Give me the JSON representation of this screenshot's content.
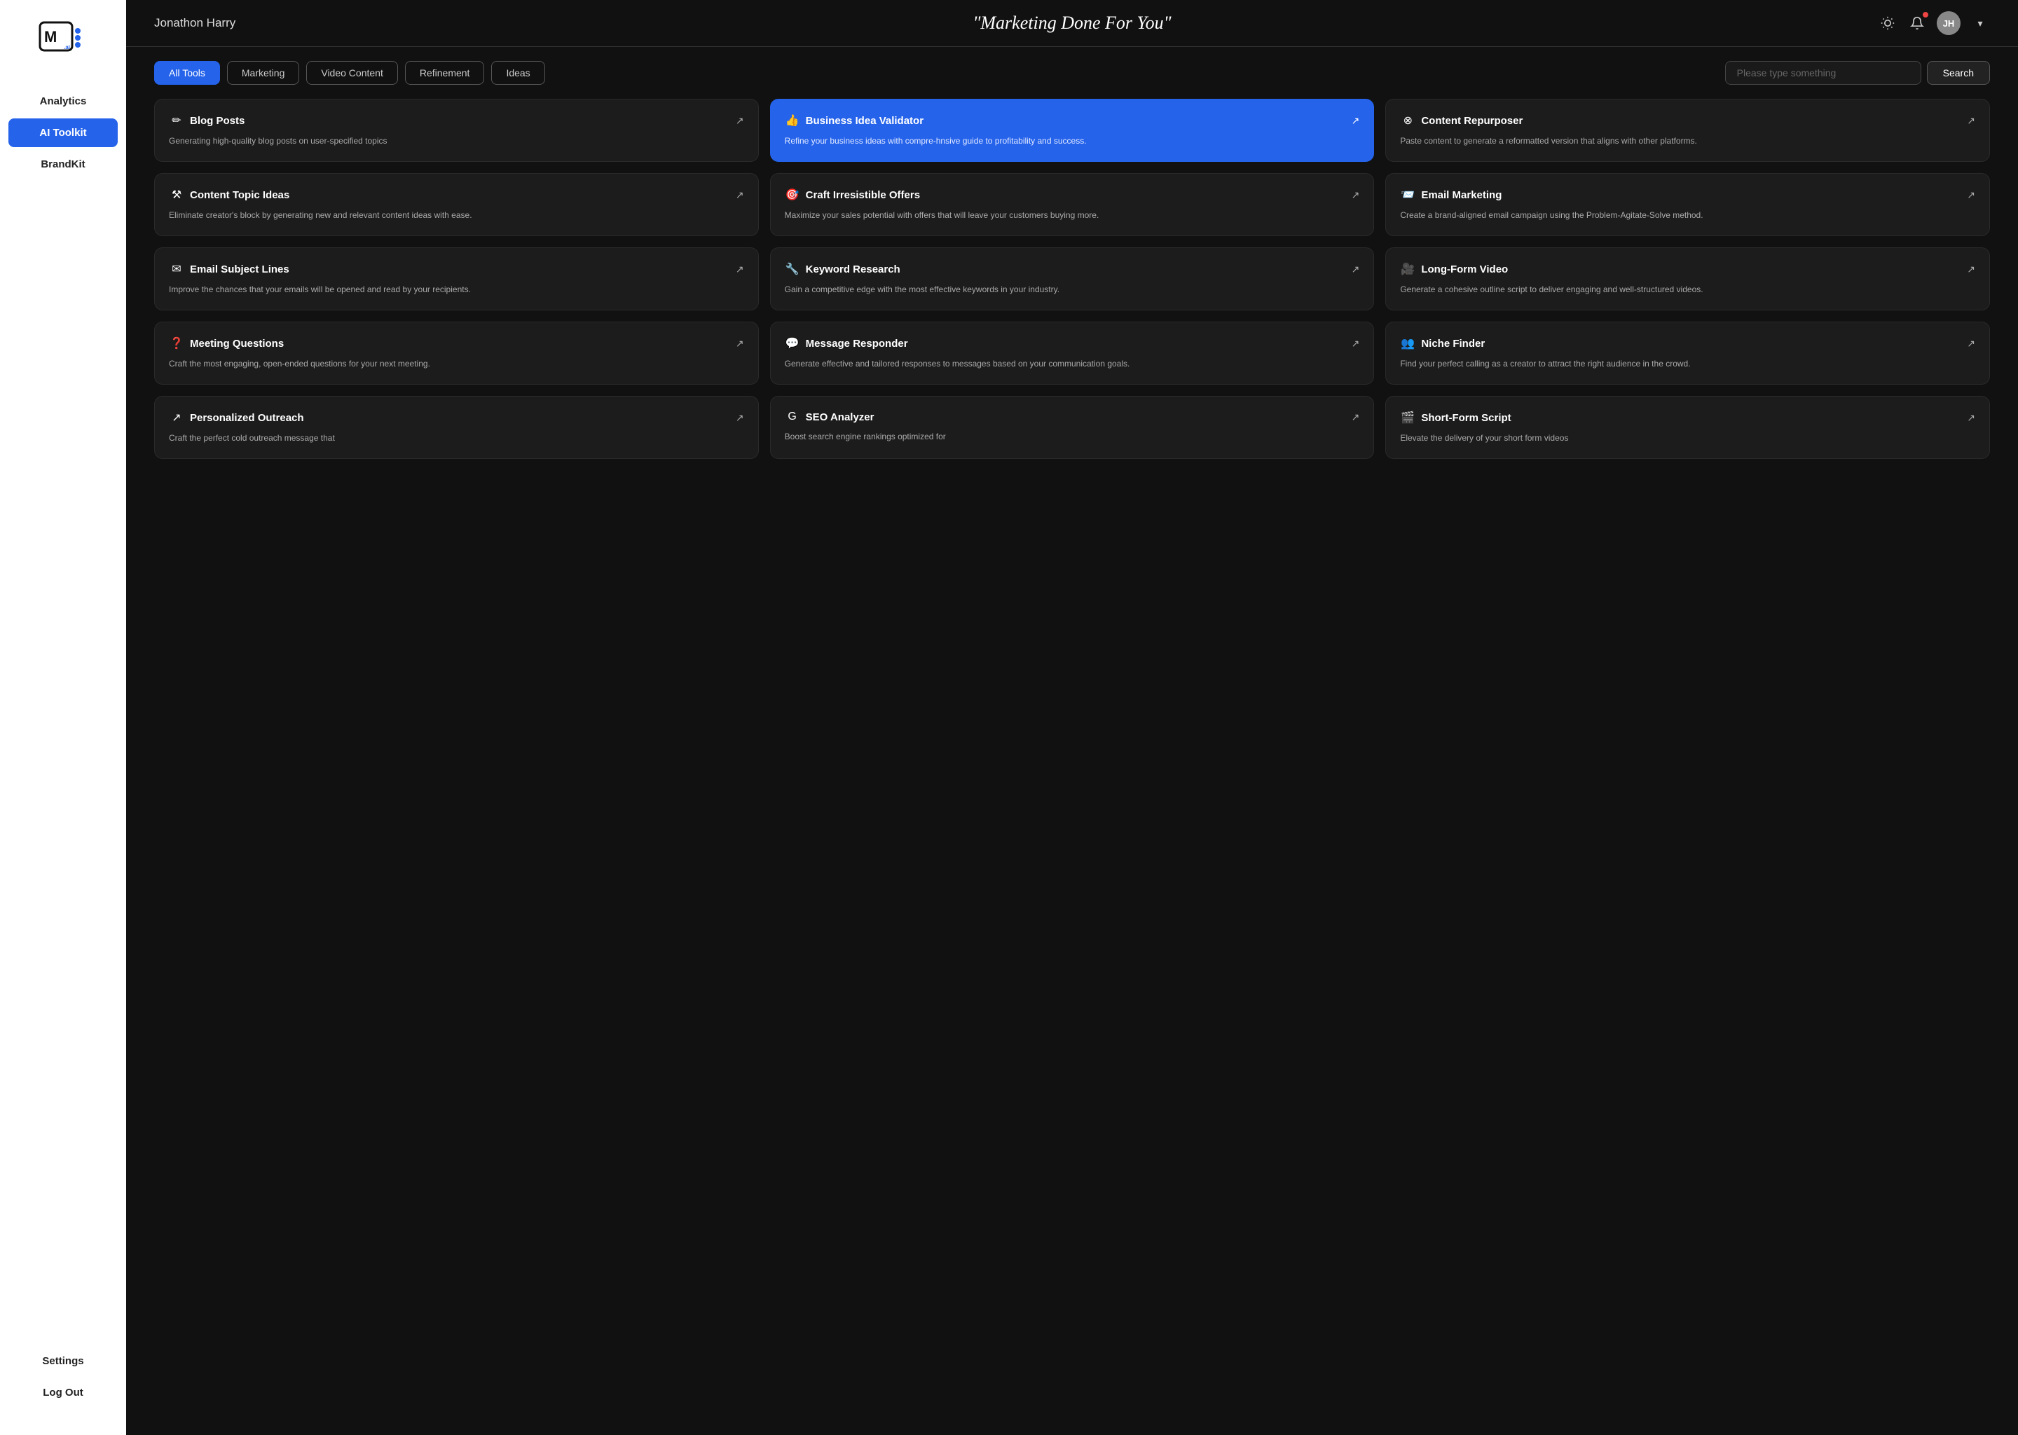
{
  "sidebar": {
    "logo_text": "M",
    "nav_items": [
      {
        "id": "analytics",
        "label": "Analytics",
        "active": false
      },
      {
        "id": "ai-toolkit",
        "label": "AI Toolkit",
        "active": true
      },
      {
        "id": "brandkit",
        "label": "BrandKit",
        "active": false
      }
    ],
    "bottom_items": [
      {
        "id": "settings",
        "label": "Settings"
      },
      {
        "id": "logout",
        "label": "Log Out"
      }
    ]
  },
  "header": {
    "user_name": "Jonathon Harry",
    "tagline": "\"Marketing Done For You\"",
    "chevron_label": "▾"
  },
  "toolbar": {
    "filters": [
      {
        "id": "all-tools",
        "label": "All Tools",
        "active": true
      },
      {
        "id": "marketing",
        "label": "Marketing",
        "active": false
      },
      {
        "id": "video-content",
        "label": "Video Content",
        "active": false
      },
      {
        "id": "refinement",
        "label": "Refinement",
        "active": false
      },
      {
        "id": "ideas",
        "label": "Ideas",
        "active": false
      }
    ],
    "search_placeholder": "Please type something",
    "search_button_label": "Search"
  },
  "tools": [
    {
      "id": "blog-posts",
      "icon": "✏️",
      "title": "Blog Posts",
      "description": "Generating high-quality blog posts on user-specified topics",
      "highlighted": false
    },
    {
      "id": "business-idea-validator",
      "icon": "👍",
      "title": "Business Idea Validator",
      "description": "Refine your business ideas with compre-hnsive guide to profitability and success.",
      "highlighted": true
    },
    {
      "id": "content-repurposer",
      "icon": "⊗",
      "title": "Content Repurposer",
      "description": "Paste content to generate a reformatted version that aligns with other platforms.",
      "highlighted": false
    },
    {
      "id": "content-topic-ideas",
      "icon": "⚒️",
      "title": "Content Topic Ideas",
      "description": "Eliminate creator's block by generating new and relevant content ideas with ease.",
      "highlighted": false
    },
    {
      "id": "craft-irresistible-offers",
      "icon": "🎯",
      "title": "Craft Irresistible Offers",
      "description": "Maximize your sales potential with offers that will leave your customers buying more.",
      "highlighted": false
    },
    {
      "id": "email-marketing",
      "icon": "📨",
      "title": "Email Marketing",
      "description": "Create a brand-aligned email campaign using the Problem-Agitate-Solve method.",
      "highlighted": false
    },
    {
      "id": "email-subject-lines",
      "icon": "✉️",
      "title": "Email Subject Lines",
      "description": "Improve the chances that your emails will be opened and read by your recipients.",
      "highlighted": false
    },
    {
      "id": "keyword-research",
      "icon": "🔧",
      "title": "Keyword Research",
      "description": "Gain a competitive edge with the most effective keywords in your industry.",
      "highlighted": false
    },
    {
      "id": "long-form-video",
      "icon": "🎥",
      "title": "Long-Form Video",
      "description": "Generate a cohesive outline script to deliver engaging and well-structured videos.",
      "highlighted": false
    },
    {
      "id": "meeting-questions",
      "icon": "❓",
      "title": "Meeting Questions",
      "description": "Craft the most engaging, open-ended questions for your next meeting.",
      "highlighted": false
    },
    {
      "id": "message-responder",
      "icon": "💬",
      "title": "Message Responder",
      "description": "Generate effective and tailored responses to messages based on your communication goals.",
      "highlighted": false
    },
    {
      "id": "niche-finder",
      "icon": "👥",
      "title": "Niche Finder",
      "description": "Find your perfect calling as a creator to attract the right audience in the crowd.",
      "highlighted": false
    },
    {
      "id": "personalized-outreach",
      "icon": "📤",
      "title": "Personalized Outreach",
      "description": "Craft the perfect cold outreach message that",
      "highlighted": false
    },
    {
      "id": "seo-analyzer",
      "icon": "G",
      "title": "SEO Analyzer",
      "description": "Boost search engine rankings optimized for",
      "highlighted": false
    },
    {
      "id": "short-form-script",
      "icon": "🎬",
      "title": "Short-Form Script",
      "description": "Elevate the delivery of your short form videos",
      "highlighted": false
    }
  ]
}
